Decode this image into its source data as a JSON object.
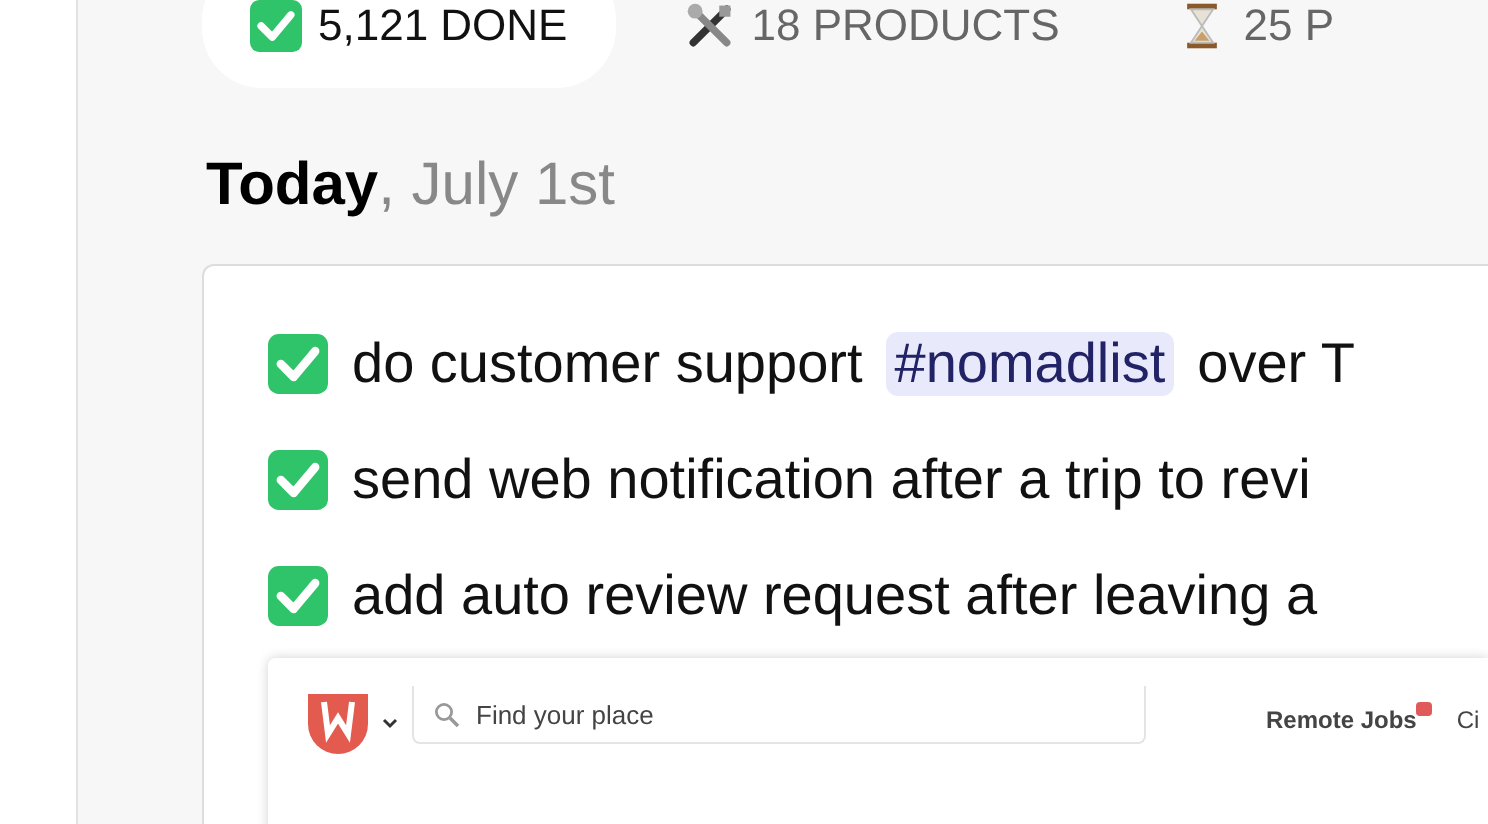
{
  "tabs": [
    {
      "kind": "done",
      "label": "5,121 DONE",
      "selected": true
    },
    {
      "kind": "products",
      "label": "18 PRODUCTS",
      "selected": false
    },
    {
      "kind": "pending",
      "label": "25 P",
      "selected": false
    }
  ],
  "day": {
    "title": "Today",
    "date": ", July 1st"
  },
  "tasks": [
    {
      "done": true,
      "text": "do customer support",
      "tag": "#nomadlist",
      "after": "over T"
    },
    {
      "done": true,
      "text": "send web notification after a trip to revi"
    },
    {
      "done": true,
      "text": "add auto review request after leaving a"
    }
  ],
  "embedded_screenshot": {
    "search_placeholder": "Find your place",
    "nav": [
      {
        "label": "Remote Jobs",
        "badge": true
      },
      {
        "label": "Ci",
        "badge": false
      }
    ]
  }
}
